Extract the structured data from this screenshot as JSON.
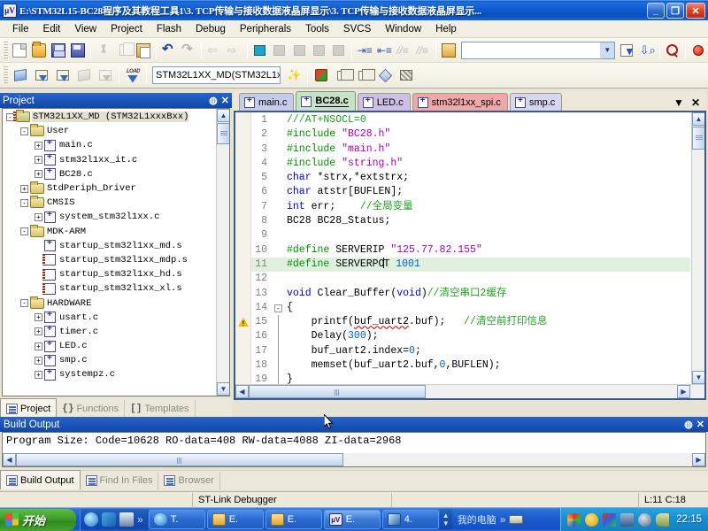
{
  "window": {
    "title": "E:\\STM32L15-BC28程序及其教程工具1\\3. TCP传输与接收数据液晶屏显示\\3. TCP传输与接收数据液晶屏显示...",
    "app_icon": "keil-uvision-icon",
    "minimize_label": "_",
    "restore_label": "❐",
    "close_label": "✕"
  },
  "menubar": {
    "items": [
      {
        "label": "File"
      },
      {
        "label": "Edit"
      },
      {
        "label": "View"
      },
      {
        "label": "Project"
      },
      {
        "label": "Flash"
      },
      {
        "label": "Debug"
      },
      {
        "label": "Peripherals"
      },
      {
        "label": "Tools"
      },
      {
        "label": "SVCS"
      },
      {
        "label": "Window"
      },
      {
        "label": "Help"
      }
    ]
  },
  "toolbar": {
    "target_combo_value": "STM32L1XX_MD(STM32L1x",
    "search_value": "",
    "row1_icons": [
      "new-file-icon",
      "open-file-icon",
      "save-icon",
      "save-all-icon",
      "cut-icon",
      "copy-icon",
      "paste-icon",
      "undo-icon",
      "redo-icon",
      "navigate-back-icon",
      "navigate-forward-icon",
      "bookmark-toggle-icon",
      "bookmark-prev-icon",
      "bookmark-next-icon",
      "bookmark-clear-icon",
      "indent-increase-icon",
      "indent-decrease-icon",
      "comment-icon",
      "uncomment-icon",
      "find-in-files-icon",
      "find-next-icon",
      "incremental-find-icon",
      "search-target-icon",
      "stop-build-icon"
    ],
    "row2_icons": [
      "translate-icon",
      "build-icon",
      "rebuild-icon",
      "batch-build-icon",
      "stop-build-2-icon",
      "load-icon",
      "target-options-icon",
      "manage-runtime-icon",
      "window-arrange-icon",
      "configure-icon",
      "diamond-icon",
      "grid-icon"
    ]
  },
  "project_panel": {
    "title": "Project",
    "pin_icon": "pin-icon",
    "close_icon": "close-icon",
    "tree": [
      {
        "label": "STM32L1XX_MD (STM32L1xxxBxx)",
        "type": "root",
        "expander": "-",
        "indent": 0,
        "selected": true
      },
      {
        "label": "User",
        "type": "folder",
        "expander": "-",
        "indent": 1
      },
      {
        "label": "main.c",
        "type": "file",
        "expander": "+",
        "indent": 2
      },
      {
        "label": "stm32l1xx_it.c",
        "type": "file",
        "expander": "+",
        "indent": 2
      },
      {
        "label": "BC28.c",
        "type": "file",
        "expander": "+",
        "indent": 2
      },
      {
        "label": "StdPeriph_Driver",
        "type": "folder",
        "expander": "+",
        "indent": 1
      },
      {
        "label": "CMSIS",
        "type": "folder",
        "expander": "-",
        "indent": 1
      },
      {
        "label": "system_stm32l1xx.c",
        "type": "file",
        "expander": "+",
        "indent": 2
      },
      {
        "label": "MDK-ARM",
        "type": "folder",
        "expander": "-",
        "indent": 1
      },
      {
        "label": "startup_stm32l1xx_md.s",
        "type": "file",
        "expander": "",
        "indent": 2
      },
      {
        "label": "startup_stm32l1xx_mdp.s",
        "type": "asm",
        "expander": "",
        "indent": 2
      },
      {
        "label": "startup_stm32l1xx_hd.s",
        "type": "asm",
        "expander": "",
        "indent": 2
      },
      {
        "label": "startup_stm32l1xx_xl.s",
        "type": "asm",
        "expander": "",
        "indent": 2
      },
      {
        "label": "HARDWARE",
        "type": "folder",
        "expander": "-",
        "indent": 1
      },
      {
        "label": "usart.c",
        "type": "file",
        "expander": "+",
        "indent": 2
      },
      {
        "label": "timer.c",
        "type": "file",
        "expander": "+",
        "indent": 2
      },
      {
        "label": "LED.c",
        "type": "file",
        "expander": "+",
        "indent": 2
      },
      {
        "label": "smp.c",
        "type": "file",
        "expander": "+",
        "indent": 2
      },
      {
        "label": "systempz.c",
        "type": "file",
        "expander": "+",
        "indent": 2
      }
    ],
    "bottom_tabs": [
      {
        "label": "Project",
        "active": true,
        "icon": "project-icon"
      },
      {
        "label": "Functions",
        "active": false,
        "icon": "braces-icon"
      },
      {
        "label": "Templates",
        "active": false,
        "icon": "templates-icon"
      }
    ]
  },
  "editor": {
    "tabs": [
      {
        "label": "main.c",
        "active": false,
        "color": "#c4ccea"
      },
      {
        "label": "BC28.c",
        "active": true,
        "color": "#c8e2c8"
      },
      {
        "label": "LED.c",
        "active": false,
        "color": "#ccc0e4"
      },
      {
        "label": "stm32l1xx_spi.c",
        "active": false,
        "color": "#efa8a8"
      },
      {
        "label": "smp.c",
        "active": false,
        "color": "#d6d6ee"
      }
    ],
    "tab_menu_icon": "chevron-down-icon",
    "tab_close_icon": "close-icon",
    "lines": [
      {
        "n": "1",
        "html": "<span class=\"cmt\">///AT+NSOCL=0</span>"
      },
      {
        "n": "2",
        "html": "<span class=\"pre\">#include</span> <span class=\"str\">\"BC28.h\"</span>"
      },
      {
        "n": "3",
        "html": "<span class=\"pre\">#include</span> <span class=\"str\">\"main.h\"</span>"
      },
      {
        "n": "4",
        "html": "<span class=\"pre\">#include</span> <span class=\"str\">\"string.h\"</span>"
      },
      {
        "n": "5",
        "html": "<span class=\"kw\">char</span> *strx,*extstrx;"
      },
      {
        "n": "6",
        "html": "<span class=\"kw\">char</span> atstr[BUFLEN];"
      },
      {
        "n": "7",
        "html": "<span class=\"kw\">int</span> err;    <span class=\"cmt\">//全局变量</span>"
      },
      {
        "n": "8",
        "html": "BC28 BC28_Status;"
      },
      {
        "n": "9",
        "html": ""
      },
      {
        "n": "10",
        "html": "<span class=\"pre\">#define</span> SERVERIP <span class=\"str\">\"125.77.82.155\"</span>"
      },
      {
        "n": "11",
        "html": "<span class=\"pre\">#define</span> SERVERPO<span class=\"caret\"></span>T <span class=\"num\">1001</span>",
        "highlight": true
      },
      {
        "n": "12",
        "html": ""
      },
      {
        "n": "13",
        "html": "<span class=\"kw\">void</span> Clear_Buffer(<span class=\"kw\">void</span>)<span class=\"cmt\">//清空串口2缓存</span>"
      },
      {
        "n": "14",
        "html": "{",
        "fold": "-"
      },
      {
        "n": "15",
        "html": "    printf(<span class=\"sq\">buf_uart2</span>.buf);   <span class=\"cmt\">//清空前打印信息</span>",
        "bar": true,
        "warn": true
      },
      {
        "n": "16",
        "html": "    Delay(<span class=\"num\">300</span>);",
        "bar": true
      },
      {
        "n": "17",
        "html": "    buf_uart2.index=<span class=\"num\">0</span>;",
        "bar": true
      },
      {
        "n": "18",
        "html": "    memset(buf_uart2.buf,<span class=\"num\">0</span>,BUFLEN);",
        "bar": true
      },
      {
        "n": "19",
        "html": "}",
        "bar": true
      }
    ]
  },
  "build_output": {
    "title": "Build Output",
    "pin_icon": "pin-icon",
    "close_icon": "close-icon",
    "text": "Program Size: Code=10628 RO-data=408 RW-data=4088 ZI-data=2968",
    "tabs": [
      {
        "label": "Build Output",
        "active": true,
        "icon": "build-output-icon"
      },
      {
        "label": "Find In Files",
        "active": false,
        "icon": "find-in-files-icon"
      },
      {
        "label": "Browser",
        "active": false,
        "icon": "browser-icon"
      }
    ]
  },
  "statusbar": {
    "left": "",
    "debugger": "ST-Link Debugger",
    "middle": "",
    "cursor": "L:11 C:18"
  },
  "taskbar": {
    "start_label": "开始",
    "quicklaunch": [
      "ie-icon",
      "outlook-icon",
      "media-icon",
      "chevron-right-icon"
    ],
    "items": [
      {
        "label": "T.",
        "icon": "ie-icon"
      },
      {
        "label": "E.",
        "icon": "folder-icon"
      },
      {
        "label": "E.",
        "icon": "folder-icon"
      },
      {
        "label": "E.",
        "icon": "keil-icon"
      },
      {
        "label": "4.",
        "icon": "app-icon"
      }
    ],
    "desk_label": "我的电脑",
    "desk_chevron": "»",
    "keyboard_icon": "keyboard-icon",
    "tray_icons": [
      "color-icon",
      "plus-icon",
      "paint-icon",
      "network-icon",
      "volume-icon",
      "usb-icon"
    ],
    "clock": "22:15"
  },
  "colors": {
    "title_blue": "#0d5bd0",
    "panel_cap_blue": "#1a56bc",
    "toolbar_bg": "#f2f0e4",
    "workspace_bg": "#e6e3d4",
    "code_highlight": "#dff0df",
    "keyword": "#0000c8",
    "preproc": "#009000",
    "string": "#b000b0",
    "comment": "#20a020",
    "number": "#0060d0"
  }
}
